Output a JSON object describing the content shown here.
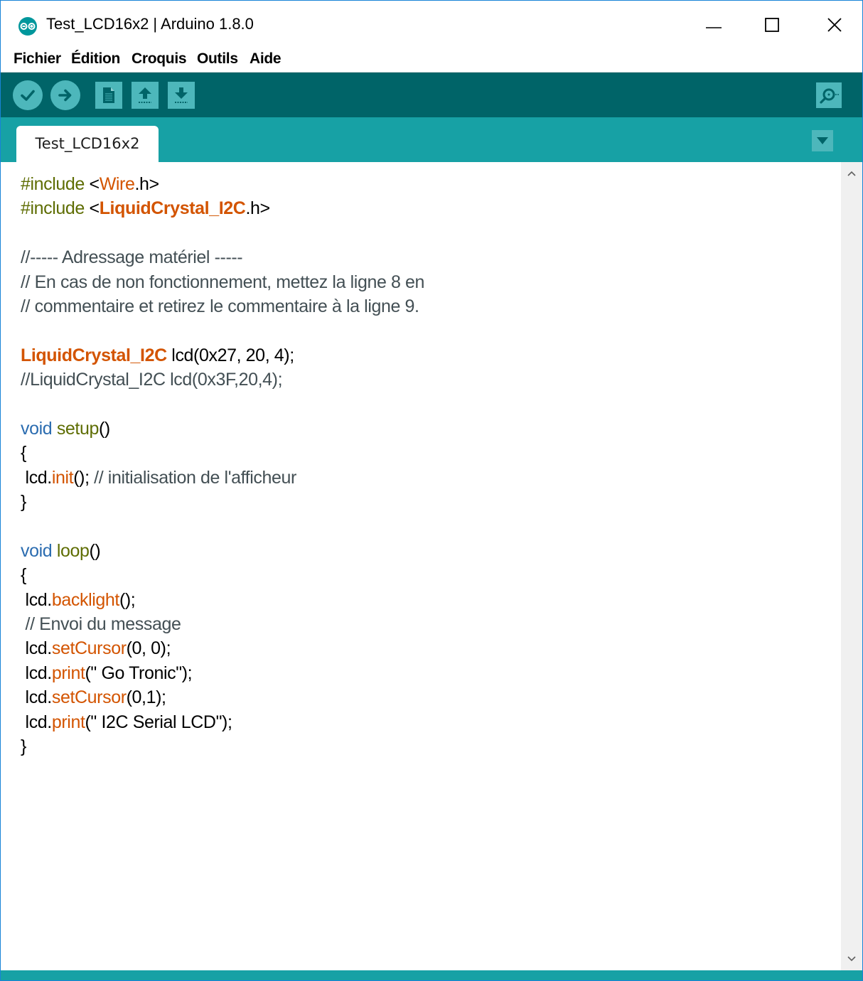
{
  "window": {
    "title": "Test_LCD16x2 | Arduino 1.8.0"
  },
  "menu": {
    "items": [
      "Fichier",
      "Édition",
      "Croquis",
      "Outils",
      "Aide"
    ]
  },
  "toolbar": {
    "buttons": [
      "verify-icon",
      "upload-icon",
      "new-icon",
      "open-icon",
      "save-icon",
      "serial-monitor-icon"
    ]
  },
  "tabs": {
    "active": "Test_LCD16x2"
  },
  "editor": {
    "lines": [
      [
        {
          "t": "#include ",
          "c": "pre"
        },
        {
          "t": "<",
          "c": ""
        },
        {
          "t": "Wire",
          "c": "lib"
        },
        {
          "t": ".h>",
          "c": ""
        }
      ],
      [
        {
          "t": "#include ",
          "c": "pre"
        },
        {
          "t": "<",
          "c": ""
        },
        {
          "t": "LiquidCrystal_I2C",
          "c": "type"
        },
        {
          "t": ".h>",
          "c": ""
        }
      ],
      [],
      [
        {
          "t": "//----- Adressage matériel -----",
          "c": "com"
        }
      ],
      [
        {
          "t": "// En cas de non fonctionnement, mettez la ligne 8 en",
          "c": "com"
        }
      ],
      [
        {
          "t": "// commentaire et retirez le commentaire à la ligne 9.",
          "c": "com"
        }
      ],
      [],
      [
        {
          "t": "LiquidCrystal_I2C",
          "c": "type"
        },
        {
          "t": " lcd(0x27, 20, 4);",
          "c": ""
        }
      ],
      [
        {
          "t": "//LiquidCrystal_I2C lcd(0x3F,20,4);",
          "c": "com"
        }
      ],
      [],
      [
        {
          "t": "void",
          "c": "kw2"
        },
        {
          "t": " ",
          "c": ""
        },
        {
          "t": "setup",
          "c": "fn"
        },
        {
          "t": "()",
          "c": ""
        }
      ],
      [
        {
          "t": "{",
          "c": ""
        }
      ],
      [
        {
          "t": " lcd.",
          "c": ""
        },
        {
          "t": "init",
          "c": "meth"
        },
        {
          "t": "(); ",
          "c": ""
        },
        {
          "t": "// initialisation de l'afficheur",
          "c": "com"
        }
      ],
      [
        {
          "t": "}",
          "c": ""
        }
      ],
      [],
      [
        {
          "t": "void",
          "c": "kw2"
        },
        {
          "t": " ",
          "c": ""
        },
        {
          "t": "loop",
          "c": "fn"
        },
        {
          "t": "()",
          "c": ""
        }
      ],
      [
        {
          "t": "{",
          "c": ""
        }
      ],
      [
        {
          "t": " lcd.",
          "c": ""
        },
        {
          "t": "backlight",
          "c": "meth"
        },
        {
          "t": "();",
          "c": ""
        }
      ],
      [
        {
          "t": " // Envoi du message",
          "c": "com"
        }
      ],
      [
        {
          "t": " lcd.",
          "c": ""
        },
        {
          "t": "setCursor",
          "c": "meth"
        },
        {
          "t": "(0, 0);",
          "c": ""
        }
      ],
      [
        {
          "t": " lcd.",
          "c": ""
        },
        {
          "t": "print",
          "c": "meth"
        },
        {
          "t": "(\" Go Tronic\");",
          "c": ""
        }
      ],
      [
        {
          "t": " lcd.",
          "c": ""
        },
        {
          "t": "setCursor",
          "c": "meth"
        },
        {
          "t": "(0,1);",
          "c": ""
        }
      ],
      [
        {
          "t": " lcd.",
          "c": ""
        },
        {
          "t": "print",
          "c": "meth"
        },
        {
          "t": "(\" I2C Serial LCD\");",
          "c": ""
        }
      ],
      [
        {
          "t": "}",
          "c": ""
        }
      ]
    ]
  },
  "colors": {
    "toolbar_bg": "#006468",
    "tabbar_bg": "#17a1a5",
    "button_bg": "#4db7bb",
    "keyword_orange": "#d35400",
    "preprocessor_green": "#5e6d03",
    "void_blue": "#2b6cb0",
    "comment_gray": "#434f54"
  }
}
